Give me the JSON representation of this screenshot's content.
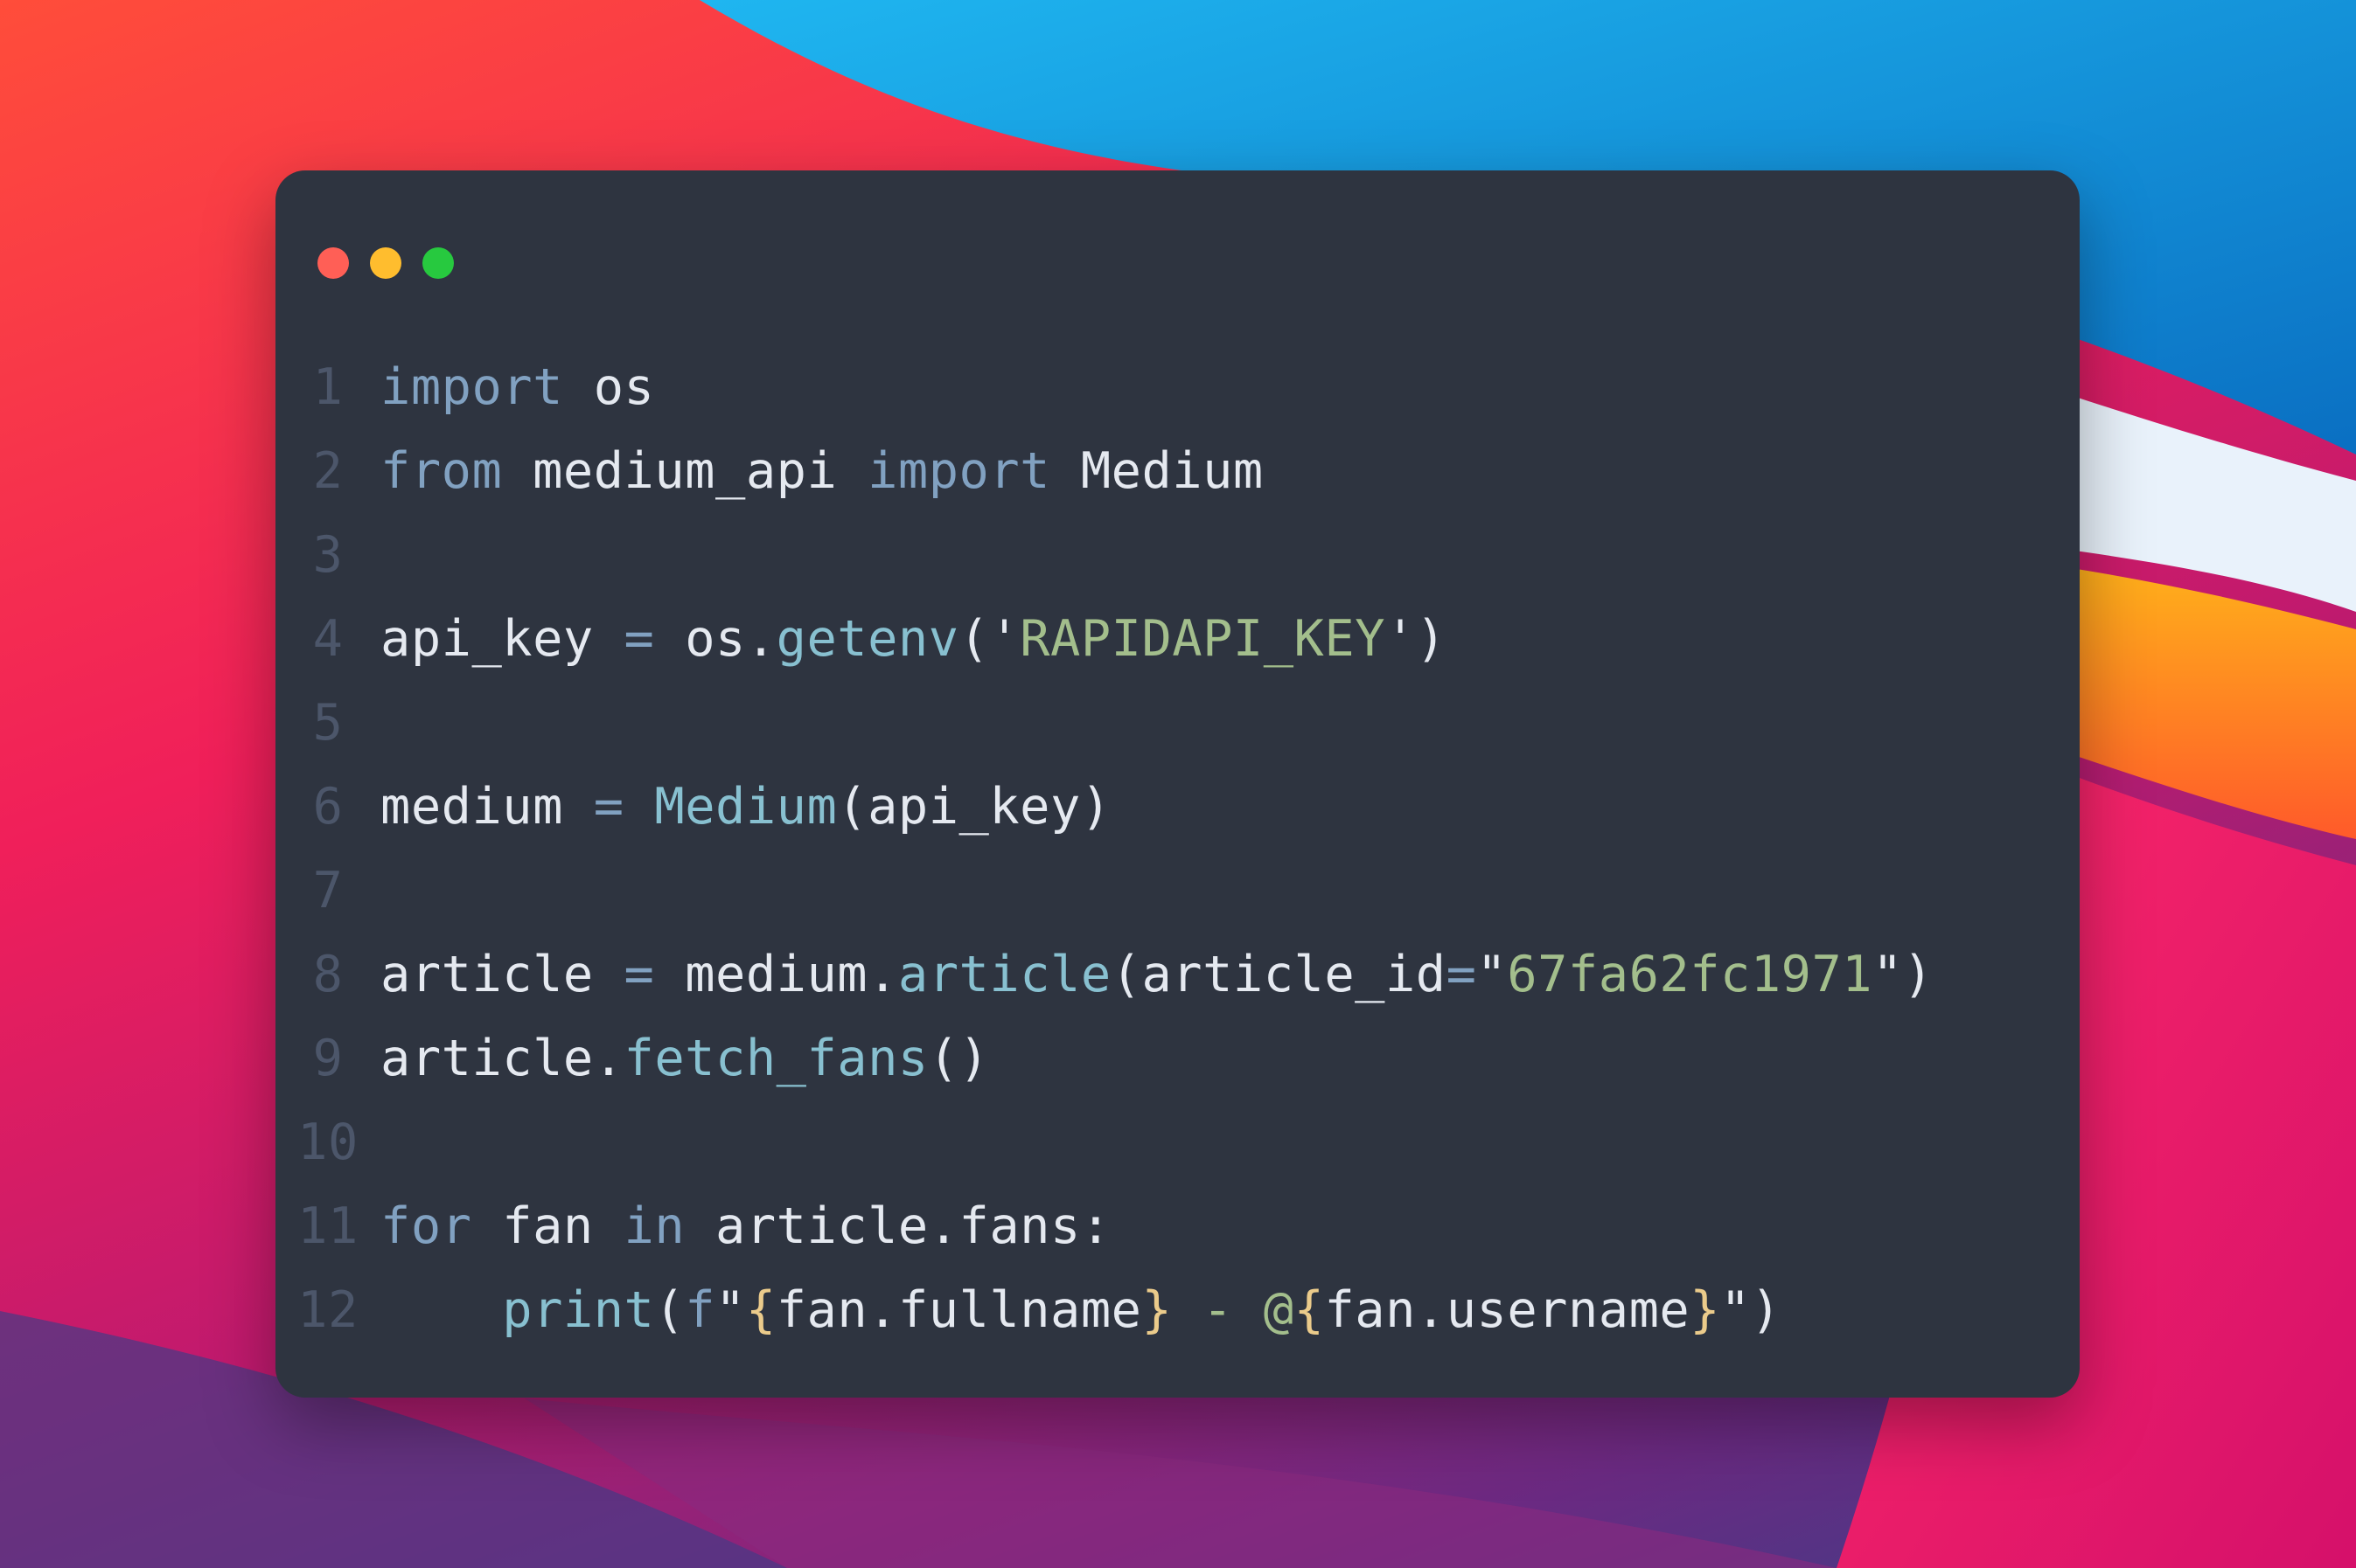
{
  "window": {
    "buttons": {
      "close_color": "#ff5f56",
      "minimize_color": "#ffbd2e",
      "zoom_color": "#27c93f"
    }
  },
  "code": {
    "lines": [
      {
        "number": "1",
        "tokens": [
          {
            "type": "kw",
            "text": "import"
          },
          {
            "type": "plain",
            "text": " os"
          }
        ]
      },
      {
        "number": "2",
        "tokens": [
          {
            "type": "kw",
            "text": "from"
          },
          {
            "type": "plain",
            "text": " medium_api "
          },
          {
            "type": "kw",
            "text": "import"
          },
          {
            "type": "plain",
            "text": " Medium"
          }
        ]
      },
      {
        "number": "3",
        "tokens": []
      },
      {
        "number": "4",
        "tokens": [
          {
            "type": "plain",
            "text": "api_key "
          },
          {
            "type": "op",
            "text": "="
          },
          {
            "type": "plain",
            "text": " os."
          },
          {
            "type": "fn",
            "text": "getenv"
          },
          {
            "type": "plain",
            "text": "('"
          },
          {
            "type": "str",
            "text": "RAPIDAPI_KEY"
          },
          {
            "type": "plain",
            "text": "')"
          }
        ]
      },
      {
        "number": "5",
        "tokens": []
      },
      {
        "number": "6",
        "tokens": [
          {
            "type": "plain",
            "text": "medium "
          },
          {
            "type": "op",
            "text": "="
          },
          {
            "type": "plain",
            "text": " "
          },
          {
            "type": "fn",
            "text": "Medium"
          },
          {
            "type": "plain",
            "text": "(api_key)"
          }
        ]
      },
      {
        "number": "7",
        "tokens": []
      },
      {
        "number": "8",
        "tokens": [
          {
            "type": "plain",
            "text": "article "
          },
          {
            "type": "op",
            "text": "="
          },
          {
            "type": "plain",
            "text": " medium."
          },
          {
            "type": "fn",
            "text": "article"
          },
          {
            "type": "plain",
            "text": "(article_id"
          },
          {
            "type": "op",
            "text": "="
          },
          {
            "type": "plain",
            "text": "\""
          },
          {
            "type": "str",
            "text": "67fa62fc1971"
          },
          {
            "type": "plain",
            "text": "\")"
          }
        ]
      },
      {
        "number": "9",
        "tokens": [
          {
            "type": "plain",
            "text": "article."
          },
          {
            "type": "fn",
            "text": "fetch_fans"
          },
          {
            "type": "plain",
            "text": "()"
          }
        ]
      },
      {
        "number": "10",
        "tokens": []
      },
      {
        "number": "11",
        "tokens": [
          {
            "type": "kw",
            "text": "for"
          },
          {
            "type": "plain",
            "text": " fan "
          },
          {
            "type": "kw",
            "text": "in"
          },
          {
            "type": "plain",
            "text": " article.fans:"
          }
        ]
      },
      {
        "number": "12",
        "tokens": [
          {
            "type": "plain",
            "text": "    "
          },
          {
            "type": "fn",
            "text": "print"
          },
          {
            "type": "plain",
            "text": "("
          },
          {
            "type": "kw",
            "text": "f"
          },
          {
            "type": "plain",
            "text": "\""
          },
          {
            "type": "brace",
            "text": "{"
          },
          {
            "type": "plain",
            "text": "fan.fullname"
          },
          {
            "type": "brace",
            "text": "}"
          },
          {
            "type": "str",
            "text": " - @"
          },
          {
            "type": "brace",
            "text": "{"
          },
          {
            "type": "plain",
            "text": "fan.username"
          },
          {
            "type": "brace",
            "text": "}"
          },
          {
            "type": "plain",
            "text": "\")"
          }
        ]
      }
    ]
  }
}
